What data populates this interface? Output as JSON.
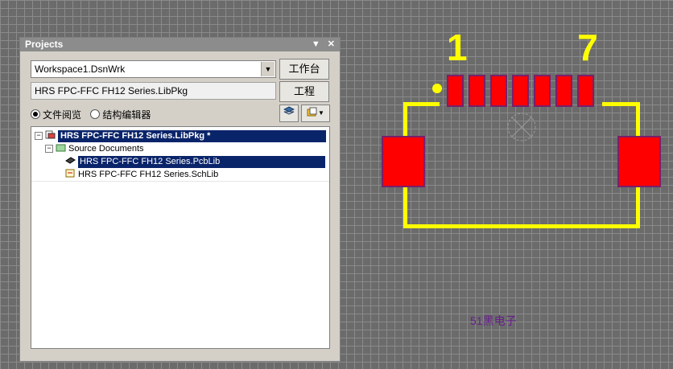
{
  "panel": {
    "title": "Projects",
    "workspace_value": "Workspace1.DsnWrk",
    "project_value": "HRS FPC-FFC FH12 Series.LibPkg",
    "workspace_button": "工作台",
    "project_button": "工程",
    "radio_file_view": "文件阅览",
    "radio_struct_editor": "结构编辑器"
  },
  "tree": {
    "project": "HRS FPC-FFC FH12 Series.LibPkg *",
    "folder": "Source Documents",
    "doc1": "HRS FPC-FFC FH12 Series.PcbLib",
    "doc2": "HRS FPC-FFC FH12 Series.SchLib"
  },
  "canvas": {
    "pin_label_first": "1",
    "pin_label_last": "7",
    "watermark": "51黑电子",
    "colors": {
      "pad": "#ff0000",
      "silkscreen": "#ffff00",
      "selection": "#0a246a"
    }
  }
}
